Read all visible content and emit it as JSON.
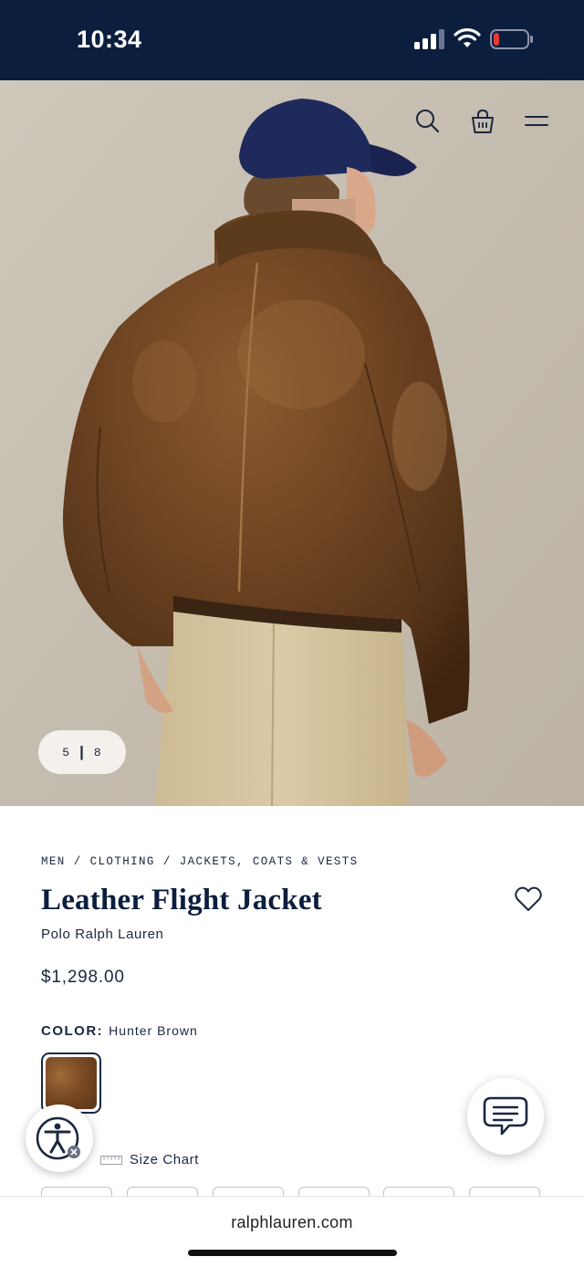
{
  "status_bar": {
    "time": "10:34",
    "signal_icon": "cellular-signal-icon",
    "wifi_icon": "wifi-icon",
    "battery_icon": "battery-low-icon",
    "battery_level": 0.12,
    "background_color": "#0c1e3e"
  },
  "hero": {
    "image_description_icon": "product-photo",
    "header_icons": [
      "search-icon",
      "shopping-bag-icon",
      "menu-icon"
    ],
    "counter": {
      "current": "5",
      "separator": "|",
      "total": "8"
    }
  },
  "product": {
    "breadcrumb": [
      "MEN",
      "CLOTHING",
      "JACKETS, COATS & VESTS"
    ],
    "breadcrumb_separator": "/",
    "title": "Leather Flight Jacket",
    "brand": "Polo Ralph Lauren",
    "price": "$1,298.00",
    "color_label": "COLOR:",
    "color_value": "Hunter Brown",
    "wishlist_icon": "heart-icon"
  },
  "size": {
    "size_chart_label": "Size Chart",
    "ruler_icon": "ruler-icon",
    "option_count_visible": 6
  },
  "floating": {
    "accessibility_icon": "accessibility-icon",
    "chat_icon": "chat-bubble-icon"
  },
  "browser": {
    "url": "ralphlauren.com"
  },
  "colors": {
    "navy": "#0c1e3e",
    "text": "#1b2740",
    "battery_red": "#e53935"
  }
}
